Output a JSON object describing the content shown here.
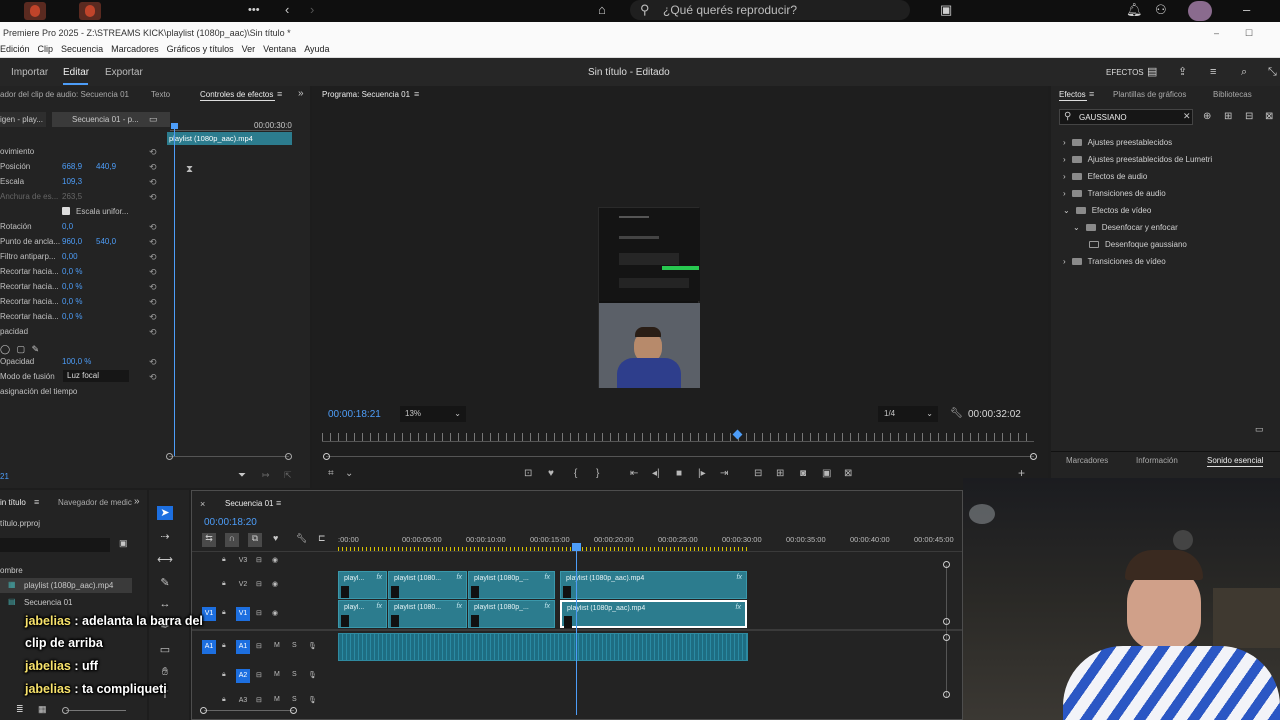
{
  "spotify": {
    "search_placeholder": "¿Qué querés reproducir?",
    "dots": "•••"
  },
  "app": {
    "title": "Premiere Pro 2025 - Z:\\STREAMS KICK\\playlist (1080p_aac)\\Sin título *"
  },
  "menu": [
    "Edición",
    "Clip",
    "Secuencia",
    "Marcadores",
    "Gráficos y títulos",
    "Ver",
    "Ventana",
    "Ayuda"
  ],
  "workspace": {
    "tabs": [
      "Importar",
      "Editar",
      "Exportar"
    ],
    "active": "Editar",
    "doc_title": "Sin título - Editado",
    "effects_label": "EFECTOS"
  },
  "left_panel": {
    "tabs": [
      "ador del clip de audio: Secuencia 01",
      "Texto",
      "Controles de efectos"
    ],
    "source_label": "igen - play...",
    "seq_label": "Secuencia 01 - p...",
    "timecode": "00:00:30:0",
    "clip_label": "playlist (1080p_aac).mp4",
    "properties": [
      {
        "label": "ovimiento",
        "v1": "",
        "v2": ""
      },
      {
        "label": "Posición",
        "v1": "668,9",
        "v2": "440,9"
      },
      {
        "label": "Escala",
        "v1": "109,3",
        "v2": ""
      },
      {
        "label": "Anchura de es...",
        "v1": "263,5",
        "v2": ""
      },
      {
        "label": "",
        "v1": "",
        "v2": "Escala unifor..."
      },
      {
        "label": "Rotación",
        "v1": "0,0",
        "v2": ""
      },
      {
        "label": "Punto de ancla...",
        "v1": "960,0",
        "v2": "540,0"
      },
      {
        "label": "Filtro antiparp...",
        "v1": "0,00",
        "v2": ""
      },
      {
        "label": "Recortar hacia...",
        "v1": "0,0 %",
        "v2": ""
      },
      {
        "label": "Recortar hacia...",
        "v1": "0,0 %",
        "v2": ""
      },
      {
        "label": "Recortar hacia...",
        "v1": "0,0 %",
        "v2": ""
      },
      {
        "label": "Recortar hacia...",
        "v1": "0,0 %",
        "v2": ""
      },
      {
        "label": "pacidad",
        "v1": "",
        "v2": ""
      },
      {
        "label": "",
        "v1": "",
        "v2": ""
      },
      {
        "label": "Opacidad",
        "v1": "100,0 %",
        "v2": ""
      },
      {
        "label": "Modo de fusión",
        "v1": "Luz focal",
        "v2": ""
      },
      {
        "label": "asignación del tiempo",
        "v1": "",
        "v2": ""
      }
    ],
    "bottom_tc": "21"
  },
  "program": {
    "title": "Programa: Secuencia 01",
    "timecode": "00:00:18:21",
    "zoom": "13%",
    "resolution": "1/4",
    "duration": "00:00:32:02",
    "playhead_fraction": 0.58
  },
  "effects": {
    "tabs": [
      "Efectos",
      "Plantillas de gráficos",
      "Bibliotecas"
    ],
    "search": "GAUSSIANO",
    "tree": [
      {
        "label": "Ajustes preestablecidos",
        "depth": 0
      },
      {
        "label": "Ajustes preestablecidos de Lumetri",
        "depth": 0
      },
      {
        "label": "Efectos de audio",
        "depth": 0
      },
      {
        "label": "Transiciones de audio",
        "depth": 0
      },
      {
        "label": "Efectos de vídeo",
        "depth": 0
      },
      {
        "label": "Desenfocar y enfocar",
        "depth": 1
      },
      {
        "label": "Desenfoque gaussiano",
        "depth": 2
      },
      {
        "label": "Transiciones de vídeo",
        "depth": 0
      }
    ],
    "bottom_tabs": [
      "Marcadores",
      "Información",
      "Sonido esencial"
    ]
  },
  "project": {
    "tabs": [
      "in título",
      "Navegador de medic"
    ],
    "file": "título.prproj",
    "col": "ombre",
    "items": [
      "playlist (1080p_aac).mp4",
      "Secuencia 01"
    ]
  },
  "timeline": {
    "seq_tab": "Secuencia 01",
    "timecode": "00:00:18:20",
    "ruler": [
      ":00:00",
      "00:00:05:00",
      "00:00:10:00",
      "00:00:15:00",
      "00:00:20:00",
      "00:00:25:00",
      "00:00:30:00",
      "00:00:35:00",
      "00:00:40:00",
      "00:00:45:00"
    ],
    "tracks": [
      "V3",
      "V2",
      "V1",
      "A1",
      "A2",
      "A3"
    ],
    "v2_clips": [
      "playl...",
      "playlist (1080...",
      "playlist (1080p_...",
      "playlist (1080p_aac).mp4"
    ],
    "v1_clips": [
      "playl...",
      "playlist (1080...",
      "playlist (1080p_...",
      "playlist (1080p_aac).mp4"
    ],
    "fx": "fx"
  },
  "chat": [
    {
      "user": "jabelias",
      "text": ": adelanta la barra del"
    },
    {
      "user": "",
      "text": "clip de arriba"
    },
    {
      "user": "jabelias",
      "text": ": uff"
    },
    {
      "user": "jabelias",
      "text": ": ta compliqueti"
    }
  ],
  "colors": {
    "accent": "#4d9df8",
    "clip": "#2c7c8e",
    "audio_clip": "#1e6d82",
    "chat_user": "#f7e26b"
  }
}
